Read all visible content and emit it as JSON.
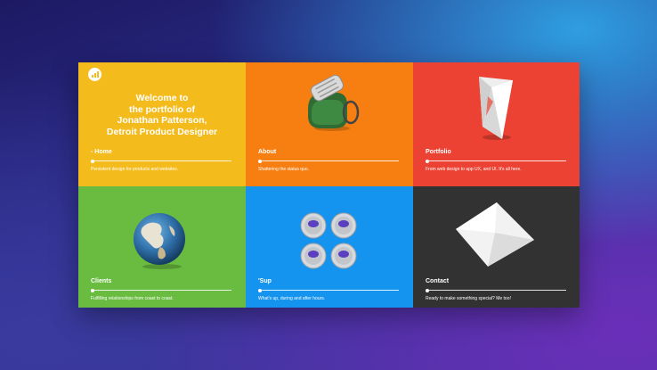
{
  "hero": {
    "line1": "Welcome to",
    "line2": "the portfolio of",
    "line3": "Jonathan Patterson,",
    "line4": "Detroit Product Designer"
  },
  "logo_icon": "bar-chart-logo",
  "colors": {
    "home": "#f4bb1d",
    "about": "#f77f12",
    "portfolio": "#eb4233",
    "clients": "#69bc3f",
    "sup": "#1493ef",
    "contact": "#323232"
  },
  "tiles": {
    "home": {
      "title": "- Home",
      "desc": "Persistent design for products and websites."
    },
    "about": {
      "title": "About",
      "desc": "Shattering the status quo."
    },
    "portfolio": {
      "title": "Portfolio",
      "desc": "From web design to app UX, and UI. It's all here."
    },
    "clients": {
      "title": "Clients",
      "desc": "Fulfilling relationships from coast to coast."
    },
    "sup": {
      "title": "'Sup",
      "desc": "What's up, during and after hours."
    },
    "contact": {
      "title": "Contact",
      "desc": "Ready to make something special? Me too!"
    }
  }
}
